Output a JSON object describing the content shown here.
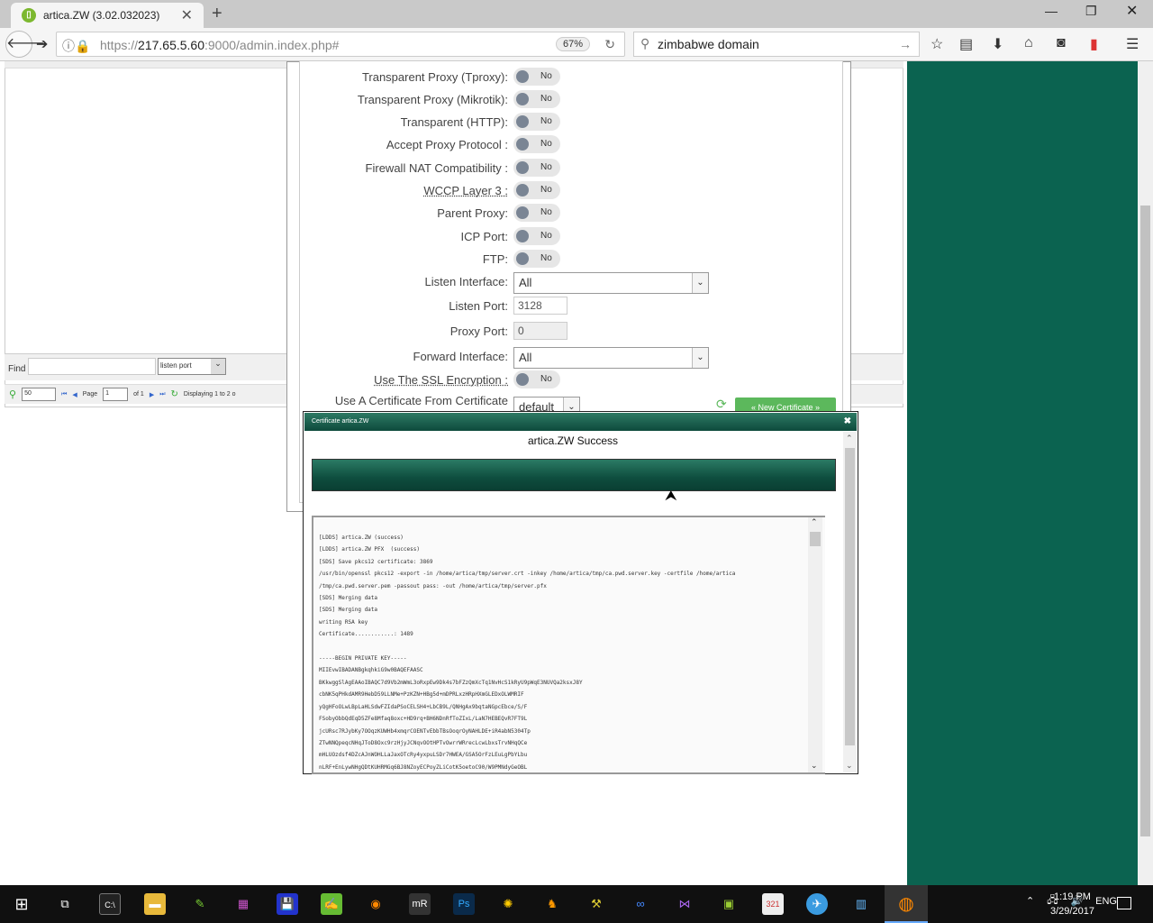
{
  "browser": {
    "tab_title": "artica.ZW (3.02.032023)",
    "url_prefix": "https://",
    "url_host": "217.65.5.60",
    "url_rest": ":9000/admin.index.php#",
    "zoom": "67%",
    "search_value": "zimbabwe domain"
  },
  "grid": {
    "find_label": "Find",
    "find_value": "",
    "find_field": "listen port",
    "page_size": "50",
    "page_label": "Page",
    "page_value": "1",
    "page_of": "of 1",
    "displaying": "Displaying 1 to 2 o"
  },
  "form": {
    "rows": [
      {
        "label": "Transparent Proxy (Tproxy):",
        "value": "No"
      },
      {
        "label": "Transparent Proxy (Mikrotik):",
        "value": "No"
      },
      {
        "label": "Transparent (HTTP):",
        "value": "No"
      },
      {
        "label": "Accept Proxy Protocol :",
        "value": "No"
      },
      {
        "label": "Firewall NAT Compatibility :",
        "value": "No"
      },
      {
        "label": "WCCP Layer 3 :",
        "value": "No"
      },
      {
        "label": "Parent Proxy:",
        "value": "No"
      },
      {
        "label": "ICP Port:",
        "value": "No"
      },
      {
        "label": "FTP:",
        "value": "No"
      }
    ],
    "listen_interface_label": "Listen Interface:",
    "listen_interface": "All",
    "listen_port_label": "Listen Port:",
    "listen_port": "3128",
    "proxy_port_label": "Proxy Port:",
    "proxy_port": "0",
    "forward_interface_label": "Forward Interface:",
    "forward_interface": "All",
    "ssl_label": "Use The SSL Encryption :",
    "ssl_value": "No",
    "cert_label": "Use A Certificate From Certificate",
    "cert_value": "default",
    "new_cert_button": "« New Certificate »"
  },
  "modal": {
    "title": "Certificate artica.ZW",
    "status": "artica.ZW Success",
    "progress_percent": 100,
    "log": [
      "[LDDS] artica.ZW (success)",
      "[LDDS] artica.ZW PFX  (success)",
      "[SDS] Save pkcs12 certificate: 3869",
      "/usr/bin/openssl pkcs12 -export -in /home/artica/tmp/server.crt -inkey /home/artica/tmp/ca.pwd.server.key -certfile /home/artica",
      "/tmp/ca.pwd.server.pem -passout pass: -out /home/artica/tmp/server.pfx",
      "[SDS] Merging data",
      "[SDS] Merging data",
      "writing RSA key",
      "Certificate............: 1489",
      "",
      "-----BEGIN PRIVATE KEY-----",
      "MIIEvwIBADANBgkqhkiG9w0BAQEFAASC",
      "BKkwggSlAgEAAoIBAQC7d9Vb2mWmL3oRxpEw9Dk4s7bFZzQmXcTq1NvHcS1kRyU9pWqE3NUVQa2ksxJ8Y",
      "cbNK5qPHkdAMR9HebD59LLNMe+PzKZN+HBg5d+mDPRLxzHRpHXmGLEDxOLWMRIF",
      "yQgHFoOLwLBpLaHLSdwFZIdaPSoCELSH4+LbCB9L/QNHgAx9bqtaNGpcEbce/S/F",
      "FSobyObbQdEqD5ZFe8Mfaq8oxc+HD9rq+BH6NDnRfToZIxL/LaN7HEBEQvR7FT9L",
      "jcURsc7RJybKy7OOqzKUWHb4xmqrCOENTvEbbTBsOoqrOyNAHLDE+iR4abN5304Tp",
      "ZTwNNQpeqcNHqJToD8Oxc9rzHjyJCNqvOOtHPTvOwrrWRrecLcwLbxsTrvNHqQCe",
      "mHLUOzdsf4DZcAJnWOHLLaJaxOTcRy4yxpuLSDr7HWEA/GSA5OrFzLEuLgPbYLbu",
      "nLRF+EnLywNHgQDtKUHRMGq6BJ8NZoyECPoyZLiCotK5oetoC90/W9PMNdyGeOBL"
    ]
  },
  "taskbar": {
    "lang": "ENG",
    "time": "1:19 PM",
    "date": "3/29/2017"
  }
}
